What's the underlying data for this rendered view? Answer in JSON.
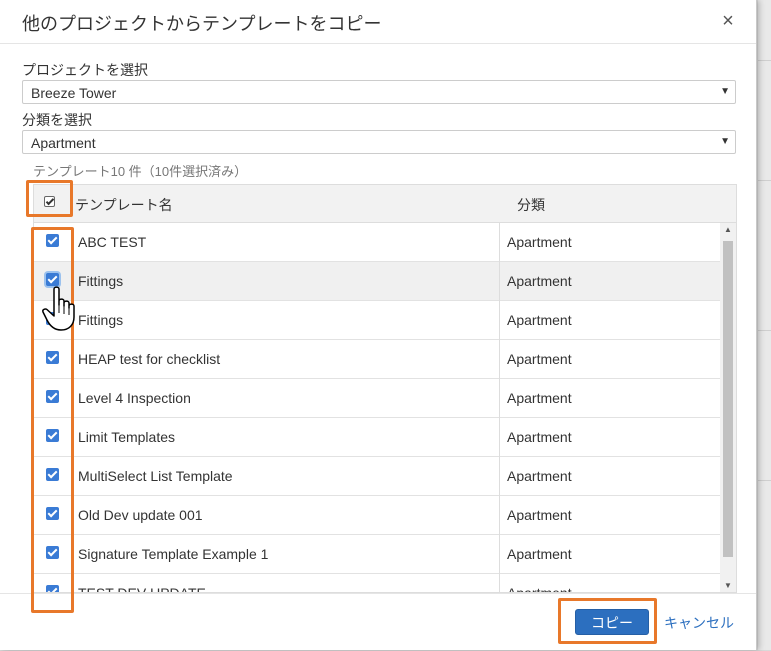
{
  "dialog": {
    "title": "他のプロジェクトからテンプレートをコピー",
    "close_icon": "×"
  },
  "project": {
    "label": "プロジェクトを選択",
    "value": "Breeze Tower",
    "arrow": "▼"
  },
  "category": {
    "label": "分類を選択",
    "value": "Apartment",
    "arrow": "▼"
  },
  "summary": "テンプレート10 件（10件選択済み）",
  "table": {
    "columns": [
      "テンプレート名",
      "分類"
    ],
    "rows": [
      {
        "name": "ABC TEST",
        "category": "Apartment",
        "checked": true
      },
      {
        "name": "Fittings",
        "category": "Apartment",
        "checked": true
      },
      {
        "name": "Fittings",
        "category": "Apartment",
        "checked": true
      },
      {
        "name": "HEAP test for checklist",
        "category": "Apartment",
        "checked": true
      },
      {
        "name": "Level 4 Inspection",
        "category": "Apartment",
        "checked": true
      },
      {
        "name": "Limit Templates",
        "category": "Apartment",
        "checked": true
      },
      {
        "name": "MultiSelect List Template",
        "category": "Apartment",
        "checked": true
      },
      {
        "name": "Old Dev update 001",
        "category": "Apartment",
        "checked": true
      },
      {
        "name": "Signature Template Example 1",
        "category": "Apartment",
        "checked": true
      },
      {
        "name": "TEST DEV UPDATE",
        "category": "Apartment",
        "checked": true
      }
    ]
  },
  "footer": {
    "copy_label": "コピー",
    "cancel_label": "キャンセル"
  },
  "colors": {
    "accent": "#2c6fbf",
    "highlight": "#e8782a",
    "checkbox": "#3a7bd5"
  }
}
